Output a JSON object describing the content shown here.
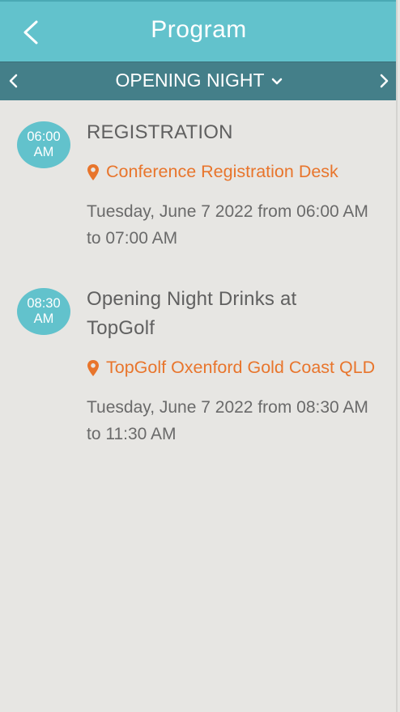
{
  "header": {
    "title": "Program",
    "back_icon": "chevron-left-icon",
    "background": "#62c2cc"
  },
  "subnav": {
    "day_label": "OPENING NIGHT",
    "prev_icon": "chevron-left-icon",
    "next_icon": "chevron-right-icon",
    "dropdown_icon": "chevron-down-icon",
    "background": "#447f89"
  },
  "accent_color": "#e8752c",
  "events": [
    {
      "time_line1": "06:00",
      "time_line2": "AM",
      "title": "REGISTRATION",
      "location": "Conference Registration Desk",
      "datetime_line1": "Tuesday, June 7 2022 from 06:00 AM",
      "datetime_line2": "to 07:00 AM"
    },
    {
      "time_line1": "08:30",
      "time_line2": "AM",
      "title_line1": "Opening Night Drinks at",
      "title_line2": "TopGolf",
      "location": "TopGolf Oxenford Gold Coast QLD",
      "datetime_line1": "Tuesday, June 7 2022 from 08:30 AM",
      "datetime_line2": "to 11:30 AM"
    }
  ]
}
